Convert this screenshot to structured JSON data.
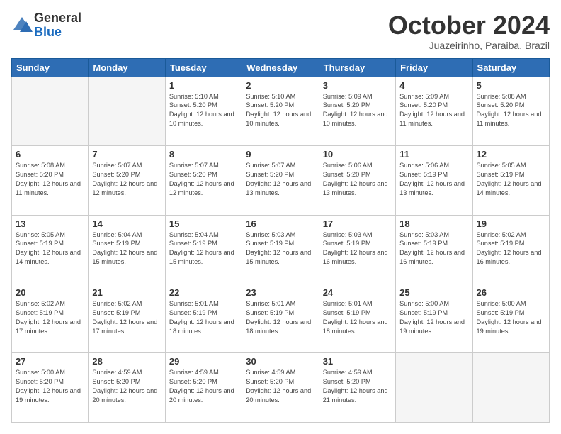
{
  "header": {
    "logo_general": "General",
    "logo_blue": "Blue",
    "month_title": "October 2024",
    "location": "Juazeirinho, Paraiba, Brazil"
  },
  "weekdays": [
    "Sunday",
    "Monday",
    "Tuesday",
    "Wednesday",
    "Thursday",
    "Friday",
    "Saturday"
  ],
  "weeks": [
    [
      {
        "day": null,
        "sunrise": null,
        "sunset": null,
        "daylight": null
      },
      {
        "day": null,
        "sunrise": null,
        "sunset": null,
        "daylight": null
      },
      {
        "day": "1",
        "sunrise": "Sunrise: 5:10 AM",
        "sunset": "Sunset: 5:20 PM",
        "daylight": "Daylight: 12 hours and 10 minutes."
      },
      {
        "day": "2",
        "sunrise": "Sunrise: 5:10 AM",
        "sunset": "Sunset: 5:20 PM",
        "daylight": "Daylight: 12 hours and 10 minutes."
      },
      {
        "day": "3",
        "sunrise": "Sunrise: 5:09 AM",
        "sunset": "Sunset: 5:20 PM",
        "daylight": "Daylight: 12 hours and 10 minutes."
      },
      {
        "day": "4",
        "sunrise": "Sunrise: 5:09 AM",
        "sunset": "Sunset: 5:20 PM",
        "daylight": "Daylight: 12 hours and 11 minutes."
      },
      {
        "day": "5",
        "sunrise": "Sunrise: 5:08 AM",
        "sunset": "Sunset: 5:20 PM",
        "daylight": "Daylight: 12 hours and 11 minutes."
      }
    ],
    [
      {
        "day": "6",
        "sunrise": "Sunrise: 5:08 AM",
        "sunset": "Sunset: 5:20 PM",
        "daylight": "Daylight: 12 hours and 11 minutes."
      },
      {
        "day": "7",
        "sunrise": "Sunrise: 5:07 AM",
        "sunset": "Sunset: 5:20 PM",
        "daylight": "Daylight: 12 hours and 12 minutes."
      },
      {
        "day": "8",
        "sunrise": "Sunrise: 5:07 AM",
        "sunset": "Sunset: 5:20 PM",
        "daylight": "Daylight: 12 hours and 12 minutes."
      },
      {
        "day": "9",
        "sunrise": "Sunrise: 5:07 AM",
        "sunset": "Sunset: 5:20 PM",
        "daylight": "Daylight: 12 hours and 13 minutes."
      },
      {
        "day": "10",
        "sunrise": "Sunrise: 5:06 AM",
        "sunset": "Sunset: 5:20 PM",
        "daylight": "Daylight: 12 hours and 13 minutes."
      },
      {
        "day": "11",
        "sunrise": "Sunrise: 5:06 AM",
        "sunset": "Sunset: 5:19 PM",
        "daylight": "Daylight: 12 hours and 13 minutes."
      },
      {
        "day": "12",
        "sunrise": "Sunrise: 5:05 AM",
        "sunset": "Sunset: 5:19 PM",
        "daylight": "Daylight: 12 hours and 14 minutes."
      }
    ],
    [
      {
        "day": "13",
        "sunrise": "Sunrise: 5:05 AM",
        "sunset": "Sunset: 5:19 PM",
        "daylight": "Daylight: 12 hours and 14 minutes."
      },
      {
        "day": "14",
        "sunrise": "Sunrise: 5:04 AM",
        "sunset": "Sunset: 5:19 PM",
        "daylight": "Daylight: 12 hours and 15 minutes."
      },
      {
        "day": "15",
        "sunrise": "Sunrise: 5:04 AM",
        "sunset": "Sunset: 5:19 PM",
        "daylight": "Daylight: 12 hours and 15 minutes."
      },
      {
        "day": "16",
        "sunrise": "Sunrise: 5:03 AM",
        "sunset": "Sunset: 5:19 PM",
        "daylight": "Daylight: 12 hours and 15 minutes."
      },
      {
        "day": "17",
        "sunrise": "Sunrise: 5:03 AM",
        "sunset": "Sunset: 5:19 PM",
        "daylight": "Daylight: 12 hours and 16 minutes."
      },
      {
        "day": "18",
        "sunrise": "Sunrise: 5:03 AM",
        "sunset": "Sunset: 5:19 PM",
        "daylight": "Daylight: 12 hours and 16 minutes."
      },
      {
        "day": "19",
        "sunrise": "Sunrise: 5:02 AM",
        "sunset": "Sunset: 5:19 PM",
        "daylight": "Daylight: 12 hours and 16 minutes."
      }
    ],
    [
      {
        "day": "20",
        "sunrise": "Sunrise: 5:02 AM",
        "sunset": "Sunset: 5:19 PM",
        "daylight": "Daylight: 12 hours and 17 minutes."
      },
      {
        "day": "21",
        "sunrise": "Sunrise: 5:02 AM",
        "sunset": "Sunset: 5:19 PM",
        "daylight": "Daylight: 12 hours and 17 minutes."
      },
      {
        "day": "22",
        "sunrise": "Sunrise: 5:01 AM",
        "sunset": "Sunset: 5:19 PM",
        "daylight": "Daylight: 12 hours and 18 minutes."
      },
      {
        "day": "23",
        "sunrise": "Sunrise: 5:01 AM",
        "sunset": "Sunset: 5:19 PM",
        "daylight": "Daylight: 12 hours and 18 minutes."
      },
      {
        "day": "24",
        "sunrise": "Sunrise: 5:01 AM",
        "sunset": "Sunset: 5:19 PM",
        "daylight": "Daylight: 12 hours and 18 minutes."
      },
      {
        "day": "25",
        "sunrise": "Sunrise: 5:00 AM",
        "sunset": "Sunset: 5:19 PM",
        "daylight": "Daylight: 12 hours and 19 minutes."
      },
      {
        "day": "26",
        "sunrise": "Sunrise: 5:00 AM",
        "sunset": "Sunset: 5:19 PM",
        "daylight": "Daylight: 12 hours and 19 minutes."
      }
    ],
    [
      {
        "day": "27",
        "sunrise": "Sunrise: 5:00 AM",
        "sunset": "Sunset: 5:20 PM",
        "daylight": "Daylight: 12 hours and 19 minutes."
      },
      {
        "day": "28",
        "sunrise": "Sunrise: 4:59 AM",
        "sunset": "Sunset: 5:20 PM",
        "daylight": "Daylight: 12 hours and 20 minutes."
      },
      {
        "day": "29",
        "sunrise": "Sunrise: 4:59 AM",
        "sunset": "Sunset: 5:20 PM",
        "daylight": "Daylight: 12 hours and 20 minutes."
      },
      {
        "day": "30",
        "sunrise": "Sunrise: 4:59 AM",
        "sunset": "Sunset: 5:20 PM",
        "daylight": "Daylight: 12 hours and 20 minutes."
      },
      {
        "day": "31",
        "sunrise": "Sunrise: 4:59 AM",
        "sunset": "Sunset: 5:20 PM",
        "daylight": "Daylight: 12 hours and 21 minutes."
      },
      {
        "day": null,
        "sunrise": null,
        "sunset": null,
        "daylight": null
      },
      {
        "day": null,
        "sunrise": null,
        "sunset": null,
        "daylight": null
      }
    ]
  ]
}
